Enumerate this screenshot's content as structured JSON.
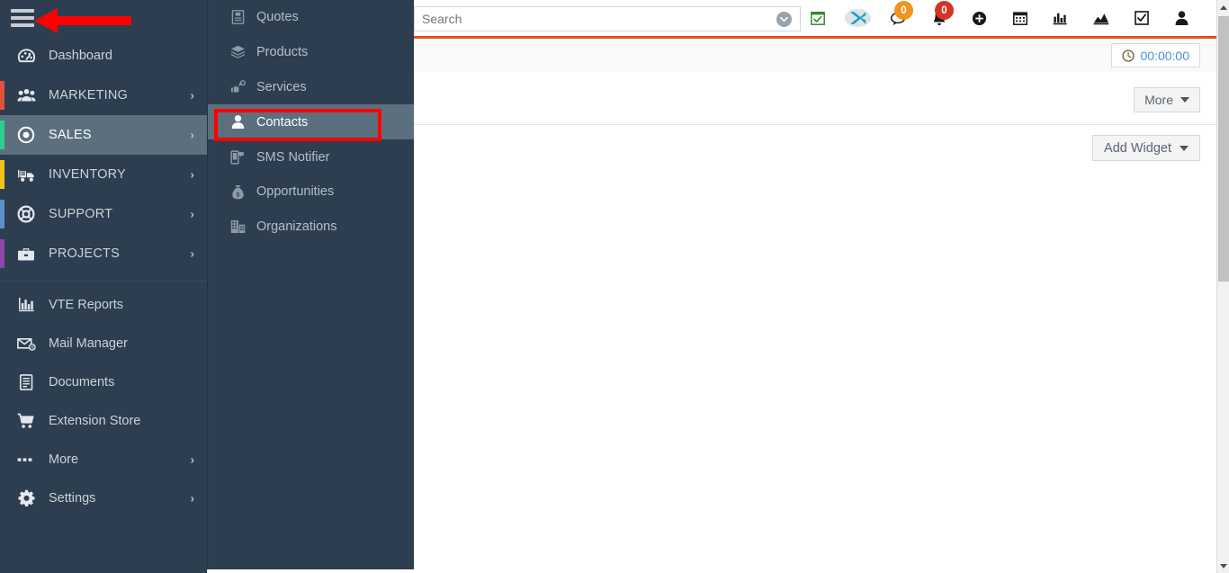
{
  "sidebar": {
    "hamburger_icon": "hamburger-menu-icon",
    "primary": [
      {
        "label": "Dashboard",
        "icon": "dashboard-gauge-icon",
        "accent": "",
        "chevron": false,
        "active": false
      },
      {
        "label": "MARKETING",
        "icon": "marketing-people-icon",
        "accent": "#e2513a",
        "chevron": true,
        "active": false
      },
      {
        "label": "SALES",
        "icon": "sales-target-icon",
        "accent": "#2ecc8f",
        "chevron": true,
        "active": true
      },
      {
        "label": "INVENTORY",
        "icon": "inventory-truck-icon",
        "accent": "#f0c419",
        "chevron": true,
        "active": false
      },
      {
        "label": "SUPPORT",
        "icon": "support-lifebuoy-icon",
        "accent": "#5b8fc9",
        "chevron": true,
        "active": false
      },
      {
        "label": "PROJECTS",
        "icon": "projects-briefcase-icon",
        "accent": "#8e44ad",
        "chevron": true,
        "active": false
      }
    ],
    "secondary": [
      {
        "label": "VTE Reports",
        "icon": "bar-chart-icon",
        "chevron": false
      },
      {
        "label": "Mail Manager",
        "icon": "envelope-at-icon",
        "chevron": false
      },
      {
        "label": "Documents",
        "icon": "document-icon",
        "chevron": false
      },
      {
        "label": "Extension Store",
        "icon": "shopping-cart-icon",
        "chevron": false
      },
      {
        "label": "More",
        "icon": "ellipsis-icon",
        "chevron": true
      },
      {
        "label": "Settings",
        "icon": "gear-icon",
        "chevron": true
      }
    ]
  },
  "submenu": {
    "parent": "SALES",
    "items": [
      {
        "label": "Quotes",
        "icon": "quote-document-icon",
        "active": false
      },
      {
        "label": "Products",
        "icon": "product-box-icon",
        "active": false
      },
      {
        "label": "Services",
        "icon": "services-wrench-icon",
        "active": false
      },
      {
        "label": "Contacts",
        "icon": "contact-person-icon",
        "active": true
      },
      {
        "label": "SMS Notifier",
        "icon": "sms-phone-icon",
        "active": false
      },
      {
        "label": "Opportunities",
        "icon": "money-bag-icon",
        "active": false
      },
      {
        "label": "Organizations",
        "icon": "organization-building-icon",
        "active": false
      }
    ]
  },
  "annotations": {
    "highlight_target": "Contacts",
    "arrow_target": "hamburger-menu-icon",
    "color": "#fe0000"
  },
  "topbar": {
    "search": {
      "value": "",
      "placeholder": "Search"
    },
    "icons": [
      {
        "name": "calendar-check-icon",
        "badge": null
      },
      {
        "name": "vtiger-x-logo-icon",
        "badge": null
      },
      {
        "name": "chat-bubble-icon",
        "badge": "0",
        "badge_color": "#f0941e"
      },
      {
        "name": "bell-notification-icon",
        "badge": "0",
        "badge_color": "#d63323"
      },
      {
        "name": "add-plus-icon",
        "badge": null
      },
      {
        "name": "calendar-icon",
        "badge": null
      },
      {
        "name": "bar-chart-icon",
        "badge": null
      },
      {
        "name": "area-chart-icon",
        "badge": null
      },
      {
        "name": "checkbox-task-icon",
        "badge": null
      },
      {
        "name": "user-profile-icon",
        "badge": null
      }
    ],
    "accent_color": "#e2511e"
  },
  "content": {
    "timer": {
      "label": "00:00:00",
      "icon": "clock-icon"
    },
    "more_button": {
      "label": "More",
      "icon": "chevron-down-icon"
    },
    "add_widget_button": {
      "label": "Add Widget",
      "icon": "chevron-down-icon"
    }
  }
}
